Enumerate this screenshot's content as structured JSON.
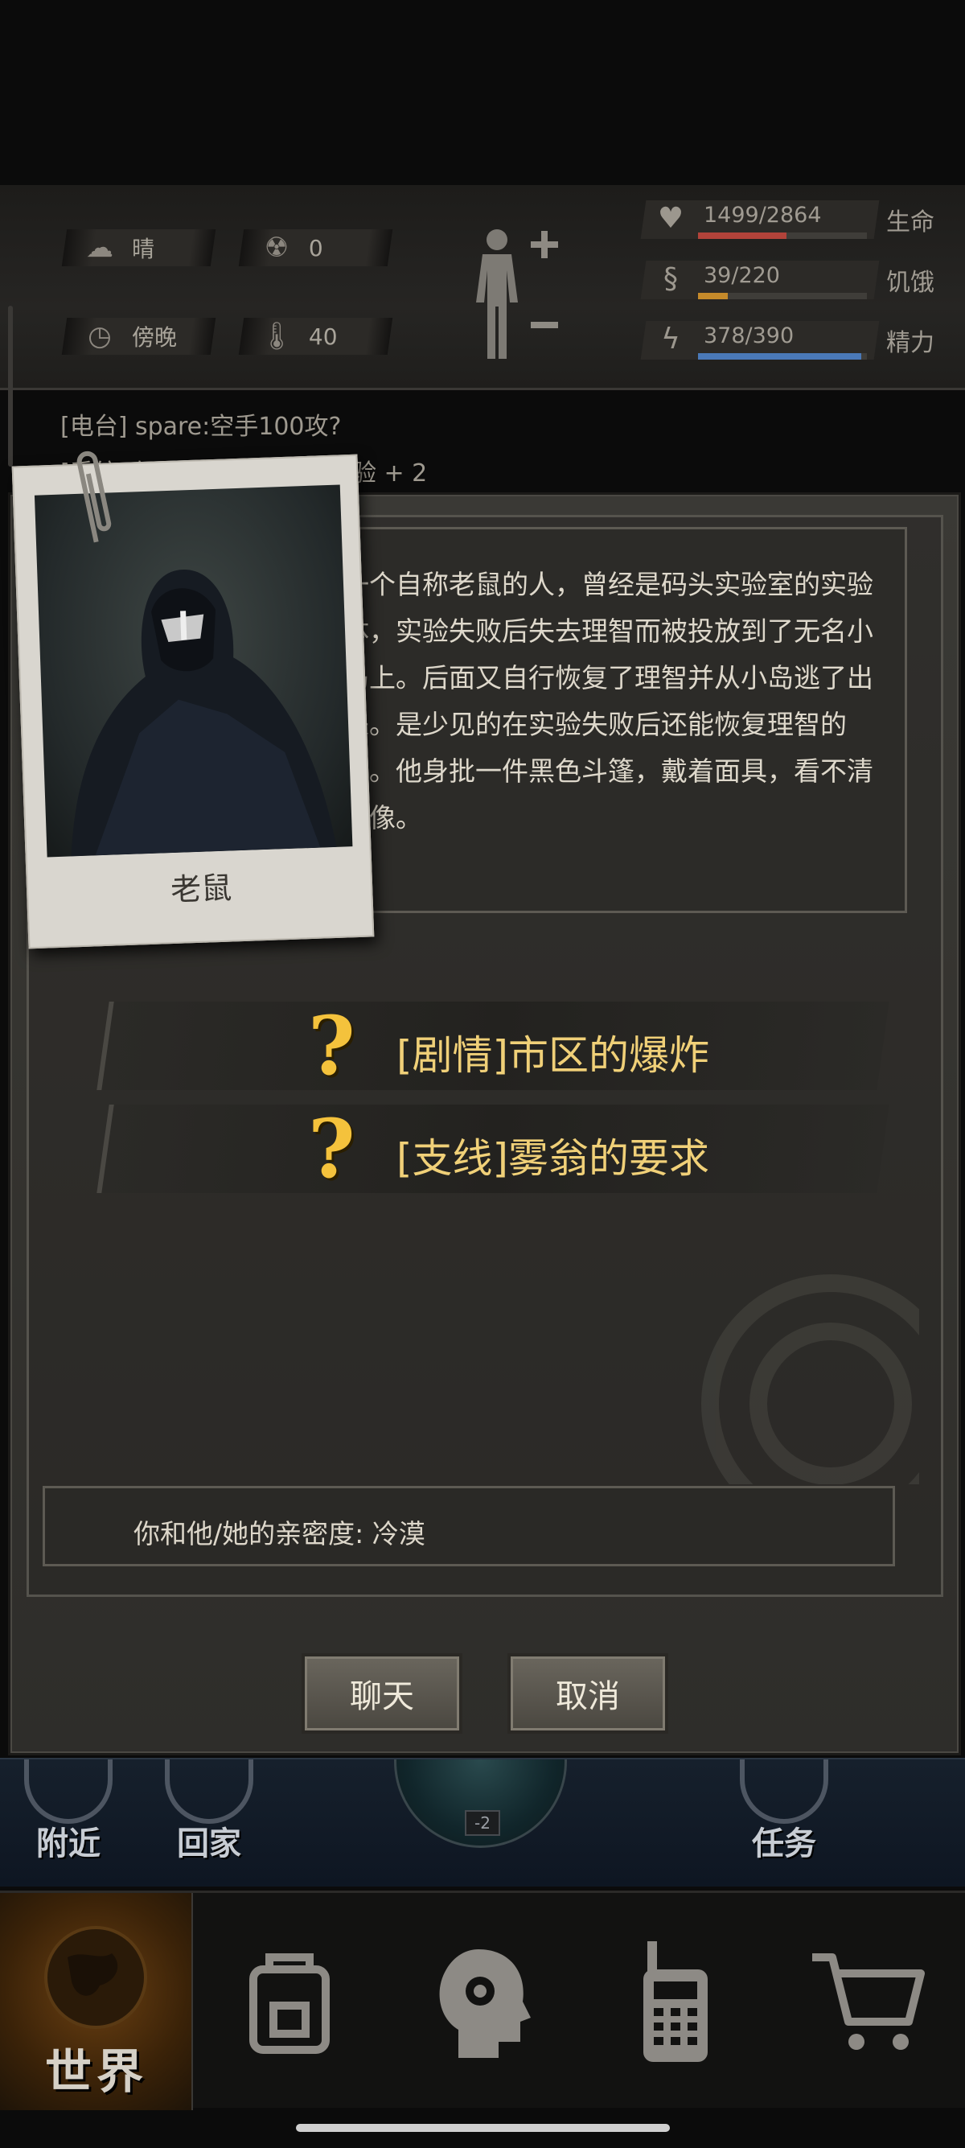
{
  "hud": {
    "weather": "晴",
    "radiation": "0",
    "time_of_day": "傍晚",
    "temperature": "40",
    "stats": [
      {
        "value": "1499/2864",
        "label": "生命",
        "fraction": 0.523,
        "color": "#b2433a",
        "icon": "heart-pulse-icon"
      },
      {
        "value": "39/220",
        "label": "饥饿",
        "fraction": 0.177,
        "color": "#c58a2a",
        "icon": "stomach-icon"
      },
      {
        "value": "378/390",
        "label": "精力",
        "fraction": 0.969,
        "color": "#4a79b8",
        "icon": "energy-icon"
      }
    ]
  },
  "log": {
    "line1": "[电台] spare:空手100攻?",
    "line2": "[系统] 知识《技能手册》经验 + 2"
  },
  "npc": {
    "name": "老鼠",
    "description": "一个自称老鼠的人，曾经是码头实验室的实验体，实验失败后失去理智而被投放到了无名小岛上。后面又自行恢复了理智并从小岛逃了出来。是少见的在实验失败后还能恢复理智的人。他身批一件黑色斗篷，戴着面具，看不清长像。"
  },
  "quests": [
    {
      "label": "[剧情]市区的爆炸"
    },
    {
      "label": "[支线]雾翁的要求"
    }
  ],
  "intimacy": "你和他/她的亲密度: 冷漠",
  "buttons": {
    "chat": "聊天",
    "cancel": "取消"
  },
  "quicknav": {
    "nearby": "附近",
    "home": "回家",
    "task": "任务",
    "radar_badge": "-2"
  },
  "tabs": {
    "world": "世界"
  }
}
